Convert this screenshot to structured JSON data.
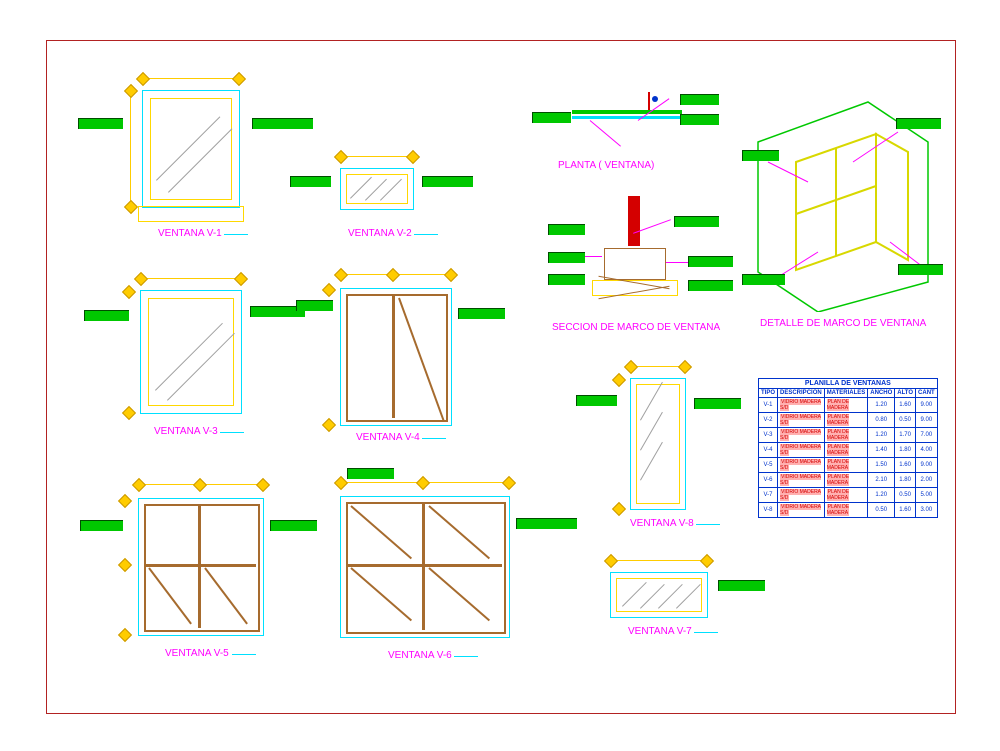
{
  "titles": {
    "v1": "VENTANA V-1",
    "v2": "VENTANA V-2",
    "v3": "VENTANA V-3",
    "v4": "VENTANA V-4",
    "v5": "VENTANA V-5",
    "v6": "VENTANA V-6",
    "v7": "VENTANA V-7",
    "v8": "VENTANA V-8",
    "planta": "PLANTA ( VENTANA)",
    "seccion": "SECCION DE MARCO DE VENTANA",
    "detalle": "DETALLE DE MARCO DE VENTANA",
    "tabla": "PLANILLA  DE  VENTANAS"
  },
  "table": {
    "headers": [
      "TIPO",
      "DESCRIPCION",
      "MATERIALES",
      "ANCHO",
      "ALTO",
      "CANT"
    ],
    "rows": [
      [
        "V-1",
        "VIDRIO MADERA S/D",
        "PLAN DE MADERA",
        "1.20",
        "1.60",
        "9.00"
      ],
      [
        "V-2",
        "VIDRIO MADERA S/D",
        "PLAN DE MADERA",
        "0.80",
        "0.50",
        "9.00"
      ],
      [
        "V-3",
        "VIDRIO MADERA S/D",
        "PLAN DE MADERA",
        "1.20",
        "1.70",
        "7.00"
      ],
      [
        "V-4",
        "VIDRIO MADERA S/D",
        "PLAN DE MADERA",
        "1.40",
        "1.80",
        "4.00"
      ],
      [
        "V-5",
        "VIDRIO MADERA S/D",
        "PLAN DE MADERA",
        "1.50",
        "1.60",
        "9.00"
      ],
      [
        "V-6",
        "VIDRIO MADERA S/D",
        "PLAN DE MADERA",
        "2.10",
        "1.80",
        "2.00"
      ],
      [
        "V-7",
        "VIDRIO MADERA S/D",
        "PLAN DE MADERA",
        "1.20",
        "0.50",
        "5.00"
      ],
      [
        "V-8",
        "VIDRIO MADERA S/D",
        "PLAN DE MADERA",
        "0.50",
        "1.60",
        "3.00"
      ]
    ]
  }
}
